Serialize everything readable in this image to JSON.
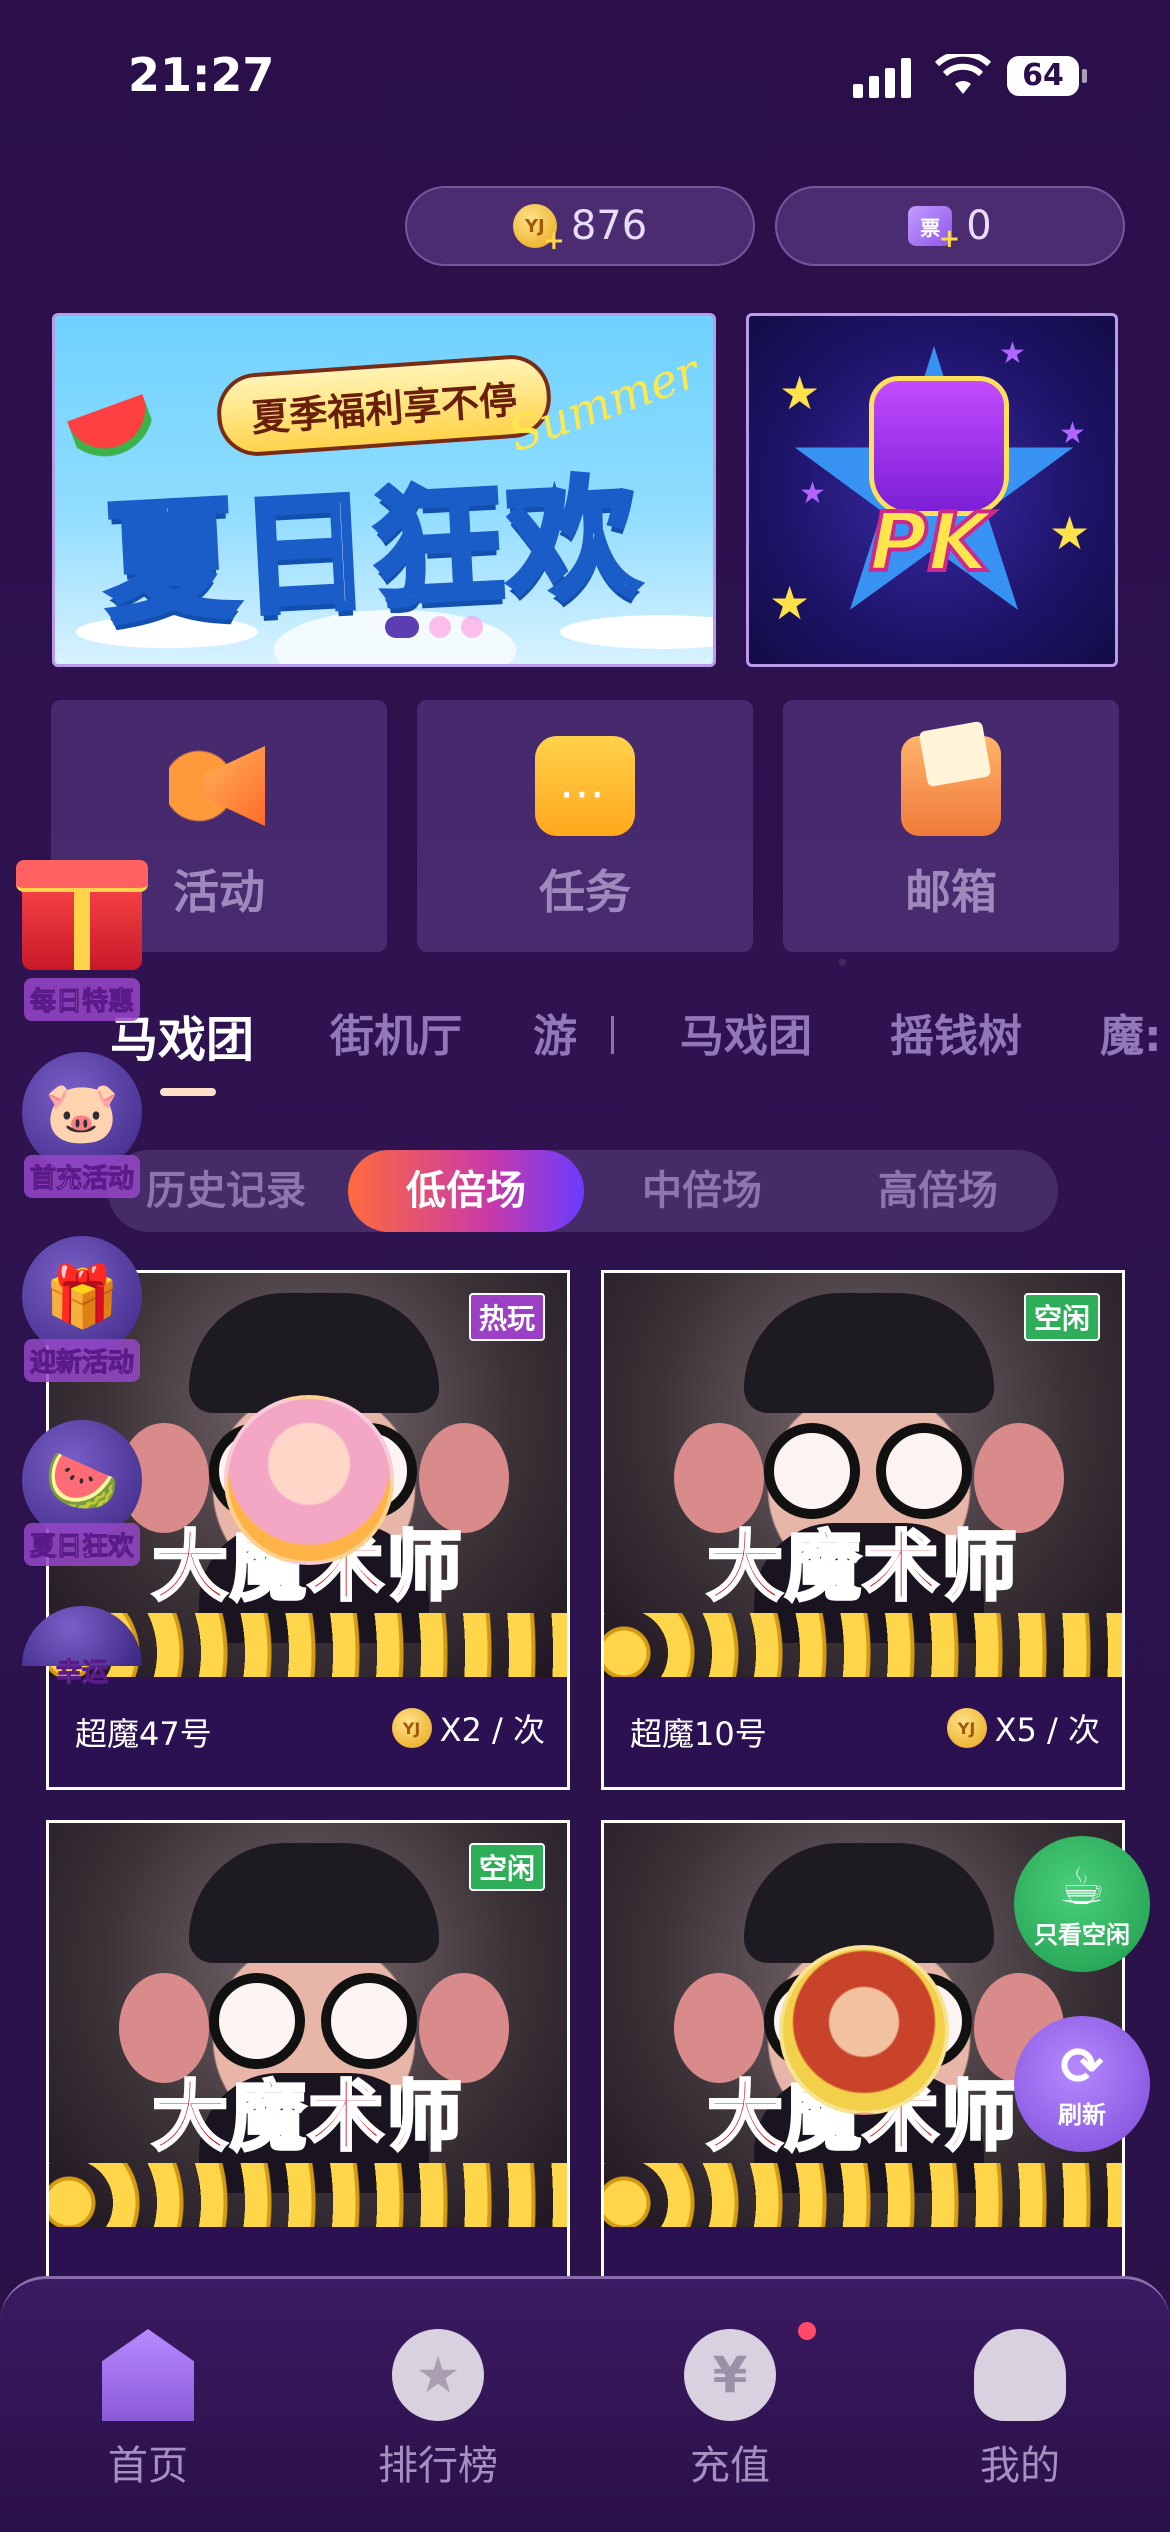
{
  "status_bar": {
    "time": "21:27",
    "battery": "64"
  },
  "currency": {
    "coins": {
      "icon_text": "YJ",
      "value": "876"
    },
    "tickets": {
      "icon_text": "票",
      "value": "0"
    }
  },
  "banners": {
    "main": {
      "subtitle": "夏季福利享不停",
      "title": "夏日狂欢",
      "deco": "Summer",
      "dot_count": 3,
      "active_dot": 0
    },
    "side": {
      "title": "PK"
    }
  },
  "quick_tiles": [
    {
      "label": "活动",
      "icon": "megaphone-icon"
    },
    {
      "label": "任务",
      "icon": "calendar-icon"
    },
    {
      "label": "邮箱",
      "icon": "mailbox-icon"
    }
  ],
  "side_floats": [
    {
      "label": "每日特惠",
      "icon": "gift-icon"
    },
    {
      "label": "首充活动",
      "icon": "piggy-bank-icon"
    },
    {
      "label": "迎新活动",
      "icon": "lucky-bag-icon"
    },
    {
      "label": "夏日狂欢",
      "icon": "summer-icon"
    },
    {
      "label": "幸运",
      "icon": "lucky-icon"
    }
  ],
  "game_tabs": {
    "items": [
      "马戏团",
      "街机厅",
      "游",
      "马戏团",
      "摇钱树",
      "魔:"
    ],
    "active": 0
  },
  "segments": {
    "items": [
      "历史记录",
      "低倍场",
      "中倍场",
      "高倍场"
    ],
    "active": 1
  },
  "machines": [
    {
      "title": "大魔术师",
      "name": "超魔47号",
      "badge": "热玩",
      "badge_type": "hot",
      "cost": "X2 / 次",
      "coin": "YJ"
    },
    {
      "title": "大魔术师",
      "name": "超魔10号",
      "badge": "空闲",
      "badge_type": "idle",
      "cost": "X5 / 次",
      "coin": "YJ"
    },
    {
      "title": "大魔术师",
      "name": "",
      "badge": "空闲",
      "badge_type": "idle",
      "cost": "",
      "coin": ""
    },
    {
      "title": "大魔术师",
      "name": "",
      "badge": "",
      "badge_type": "hot",
      "cost": "",
      "coin": ""
    }
  ],
  "floating_actions": [
    {
      "label": "只看空闲",
      "icon": "coffee-cup-icon"
    },
    {
      "label": "刷新",
      "icon": "refresh-icon"
    }
  ],
  "bottom_nav": [
    {
      "label": "首页",
      "icon": "home-icon",
      "glyph": ""
    },
    {
      "label": "排行榜",
      "icon": "ranking-icon",
      "glyph": "★"
    },
    {
      "label": "充值",
      "icon": "recharge-icon",
      "glyph": "¥"
    },
    {
      "label": "我的",
      "icon": "profile-icon",
      "glyph": ""
    }
  ],
  "colors": {
    "background": "#2a0f4a",
    "accent_gradient_start": "#ff6a3d",
    "accent_gradient_end": "#6a3bff",
    "idle_badge": "#2fae5a",
    "hot_badge": "#9b3fc4",
    "title_red": "#c8141e"
  }
}
